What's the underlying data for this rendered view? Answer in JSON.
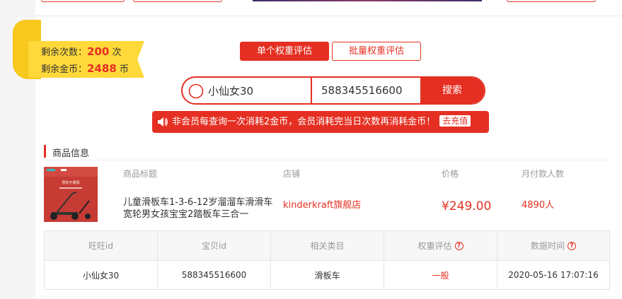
{
  "quota": {
    "times_label": "剩余次数：",
    "times_value": "200",
    "times_unit": "次",
    "coins_label": "剩余金币：",
    "coins_value": "2488",
    "coins_unit": "币"
  },
  "tabs": [
    {
      "label": "单个权重评估",
      "active": true
    },
    {
      "label": "批量权重评估",
      "active": false
    }
  ],
  "search": {
    "name_value": "小仙女30",
    "id_value": "588345516600",
    "button_label": "搜索"
  },
  "notice": {
    "text": "非会员每查询一次消耗2金币，会员消耗完当日次数再消耗金币！",
    "recharge_label": "去充值"
  },
  "product_section": {
    "title": "商品信息",
    "headers": {
      "title": "商品标题",
      "shop": "店铺",
      "price": "价格",
      "buyers": "月付款人数"
    },
    "thumb_caption_line1": "冒险不畏惧",
    "product": {
      "title": "儿童滑板车1-3-6-12岁溜溜车滑滑车宽轮男女孩宝宝2踏板车三合一",
      "shop": "kinderkraft旗舰店",
      "price": "¥249.00",
      "buyers": "4890人"
    }
  },
  "result_table": {
    "columns": [
      "旺旺id",
      "宝贝id",
      "相关类目",
      "权重评估",
      "数据时间"
    ],
    "row": [
      "小仙女30",
      "588345516600",
      "滑板车",
      "一般",
      "2020-05-16 17:07:16"
    ]
  },
  "colors": {
    "accent": "#e52f22",
    "ribbon": "#ffd83a"
  }
}
